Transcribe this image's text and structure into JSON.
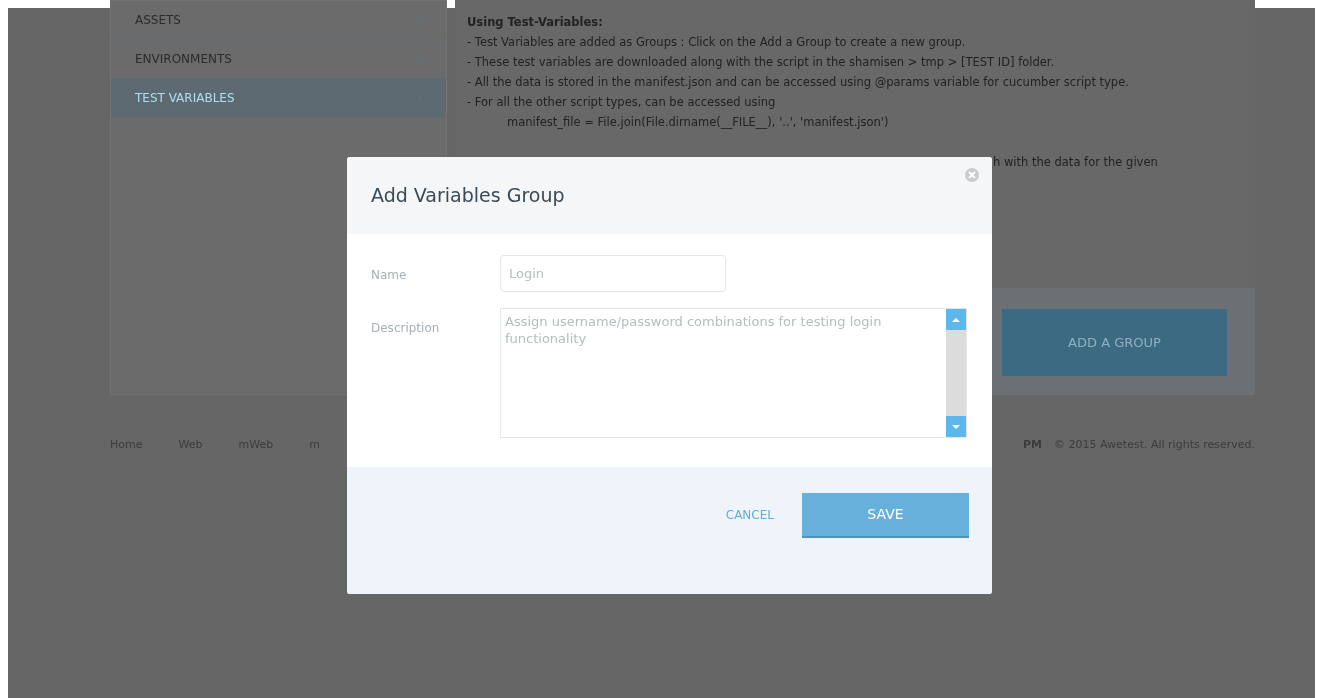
{
  "sidebar": {
    "items": [
      {
        "label": "ASSETS",
        "selected": false
      },
      {
        "label": "ENVIRONMENTS",
        "selected": false
      },
      {
        "label": "TEST VARIABLES",
        "selected": true
      }
    ]
  },
  "help": {
    "heading": "Using Test-Variables:",
    "lines": [
      "- Test Variables are added as Groups : Click on the Add a Group to create a new group.",
      "- These test variables are downloaded along with the script in the shamisen > tmp > [TEST ID] folder.",
      "- All the data is stored in the manifest.json and can be accessed using @params variable for cucumber script type.",
      "- For all the other script types, can be accessed using",
      "manifest_file = File.join(File.dirname(__FILE__), '..', 'manifest.json')"
    ],
    "fragment": "h with the data for the given"
  },
  "add_group_button": "ADD A GROUP",
  "footer": {
    "links": [
      "Home",
      "Web",
      "mWeb",
      "m"
    ],
    "right_fragment": "PM",
    "copyright": "© 2015 Awetest. All rights reserved."
  },
  "dialog": {
    "title": "Add Variables Group",
    "fields": [
      {
        "label": "Name",
        "kind": "input",
        "placeholder": "Login"
      },
      {
        "label": "Description",
        "kind": "textarea",
        "placeholder": "Assign username/password combinations for testing login functionality"
      }
    ],
    "cancel": "CANCEL",
    "save": "SAVE"
  }
}
